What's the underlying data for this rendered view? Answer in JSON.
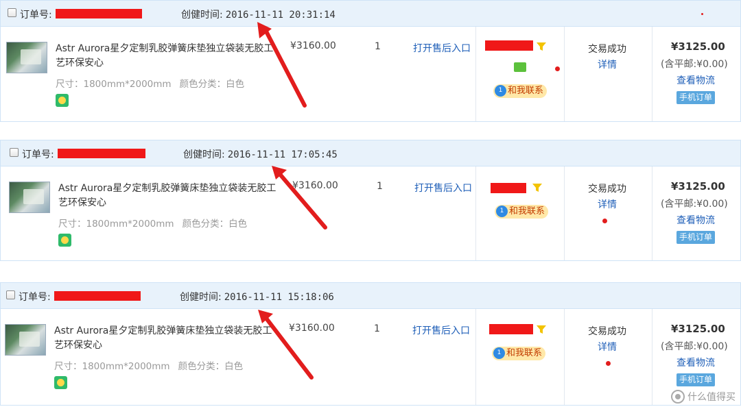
{
  "labels": {
    "order_no": "订单号:",
    "created": "创健时间:",
    "product_title": "Astr Aurora星夕定制乳胶弹簧床垫独立袋装无胶工艺环保安心",
    "spec_size": "尺寸：1800mm*2000mm",
    "spec_color": "颜色分类：白色",
    "price": "¥3160.00",
    "qty": "1",
    "after_sale": "打开售后入口",
    "contact": "和我联系",
    "status": "交易成功",
    "detail": "详情",
    "total": "¥3125.00",
    "shipping": "(含平邮:¥0.00)",
    "logistics": "查看物流",
    "mobile_order": "手机订单"
  },
  "orders": [
    {
      "created_time": "2016-11-11 20:31:14"
    },
    {
      "created_time": "2016-11-11 17:05:45"
    },
    {
      "created_time": "2016-11-11 15:18:06"
    }
  ],
  "colors": {
    "header_bg": "#e8f2fb",
    "link": "#1f5fb8",
    "redaction": "#f01818",
    "arrow": "#e21d1d"
  },
  "watermark": {
    "text": "什么值得买"
  }
}
